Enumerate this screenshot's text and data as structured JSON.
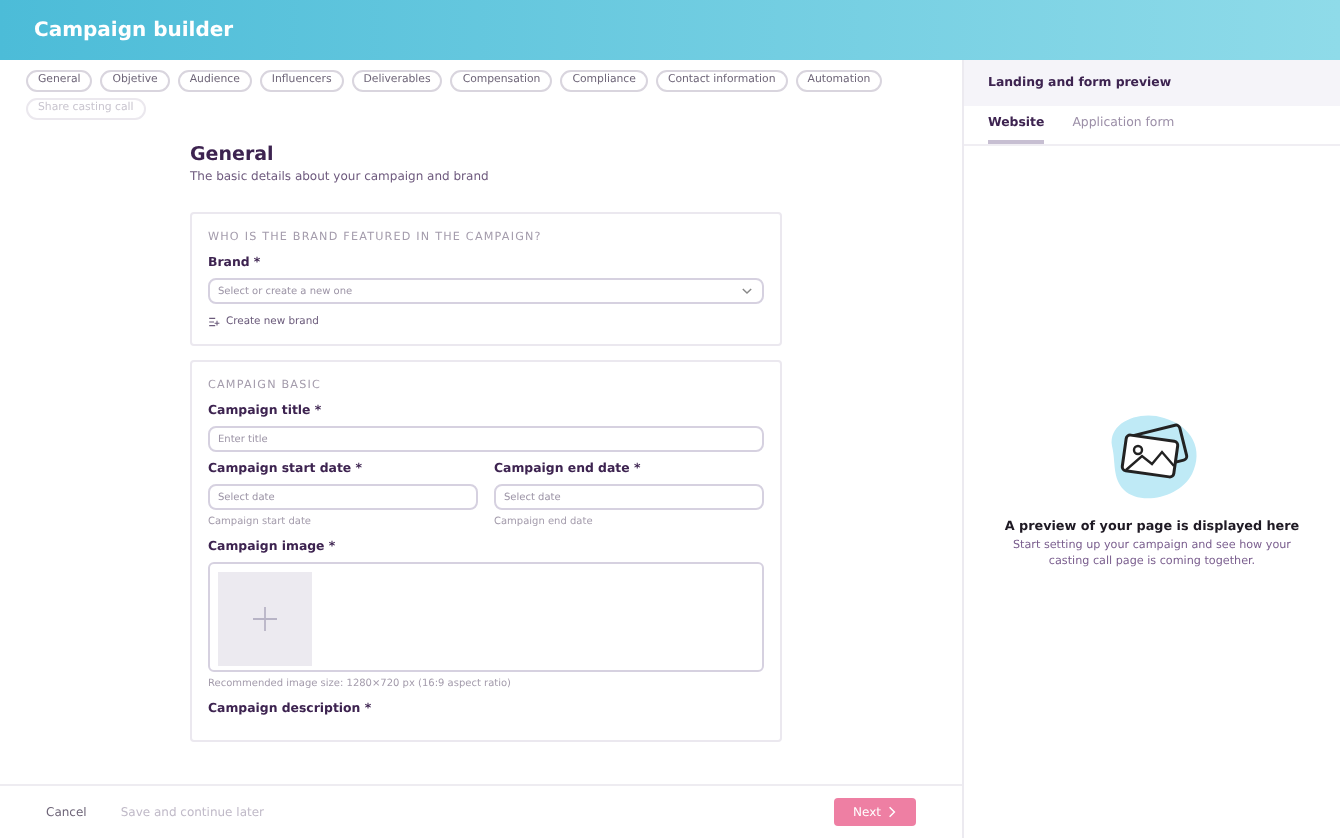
{
  "window": {
    "title": "Campaign builder"
  },
  "steps": [
    {
      "label": "General",
      "disabled": false
    },
    {
      "label": "Objetive",
      "disabled": false
    },
    {
      "label": "Audience",
      "disabled": false
    },
    {
      "label": "Influencers",
      "disabled": false
    },
    {
      "label": "Deliverables",
      "disabled": false
    },
    {
      "label": "Compensation",
      "disabled": false
    },
    {
      "label": "Compliance",
      "disabled": false
    },
    {
      "label": "Contact information",
      "disabled": false
    },
    {
      "label": "Automation",
      "disabled": false
    },
    {
      "label": "Share casting call",
      "disabled": true
    }
  ],
  "section": {
    "title": "General",
    "subtitle": "The basic details about your campaign and brand"
  },
  "brand_card": {
    "heading": "WHO IS THE BRAND FEATURED IN THE CAMPAIGN?",
    "label": "Brand *",
    "placeholder": "Select or create a new one",
    "link": "Create new brand"
  },
  "basic_card": {
    "heading": "CAMPAIGN BASIC",
    "title_label": "Campaign title *",
    "title_placeholder": "Enter title",
    "dates": [
      {
        "label": "Campaign start date *",
        "placeholder": "Select date",
        "hint": "Campaign start date"
      },
      {
        "label": "Campaign end date *",
        "placeholder": "Select date",
        "hint": "Campaign end date"
      }
    ],
    "image_label": "Campaign image *",
    "image_hint": "Recommended image size: 1280×720 px (16:9 aspect ratio)",
    "description_label": "Campaign description *"
  },
  "footer": {
    "cancel": "Cancel",
    "save": "Save and continue later",
    "next": "Next",
    "next_disabled": true
  },
  "preview": {
    "title": "Landing and form preview",
    "tabs": [
      {
        "label": "Website",
        "selected": true
      },
      {
        "label": "Application form",
        "selected": false
      }
    ],
    "empty_title": "A preview of your page is displayed here",
    "empty_text": "Start setting up your campaign and see how your casting call page is coming together."
  }
}
